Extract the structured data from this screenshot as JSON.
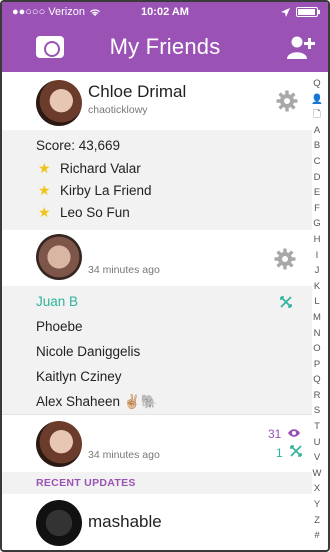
{
  "status_bar": {
    "carrier": "●●○○○ Verizon",
    "time": "10:02 AM",
    "battery_level": 0.95
  },
  "header": {
    "title": "My Friends"
  },
  "index_rail": [
    "Q",
    "👤",
    "🗋",
    "A",
    "B",
    "C",
    "D",
    "E",
    "F",
    "G",
    "H",
    "I",
    "J",
    "K",
    "L",
    "M",
    "N",
    "O",
    "P",
    "Q",
    "R",
    "S",
    "T",
    "U",
    "V",
    "W",
    "X",
    "Y",
    "Z",
    "#"
  ],
  "friend_card": {
    "name": "Chloe Drimal",
    "username": "chaoticklowy",
    "score_label": "Score: 43,669",
    "best_friends": [
      "Richard Valar",
      "Kirby La Friend",
      "Leo So Fun"
    ]
  },
  "story_card": {
    "time": "34 minutes ago"
  },
  "friends_list": [
    {
      "name": "Juan B",
      "highlight": true
    },
    {
      "name": "Phoebe",
      "highlight": false
    },
    {
      "name": "Nicole Daniggelis",
      "highlight": false
    },
    {
      "name": "Kaitlyn Cziney",
      "highlight": false
    },
    {
      "name": "Alex Shaheen ✌🏼🐘",
      "highlight": false
    }
  ],
  "stats_card": {
    "time": "34 minutes ago",
    "views": "31",
    "screenshots": "1"
  },
  "recent_updates": {
    "label": "RECENT UPDATES",
    "items": [
      {
        "name": "mashable"
      }
    ]
  },
  "colors": {
    "brand_purple": "#9b52b5",
    "accent_green": "#2fb39a",
    "star_yellow": "#f0c418"
  }
}
